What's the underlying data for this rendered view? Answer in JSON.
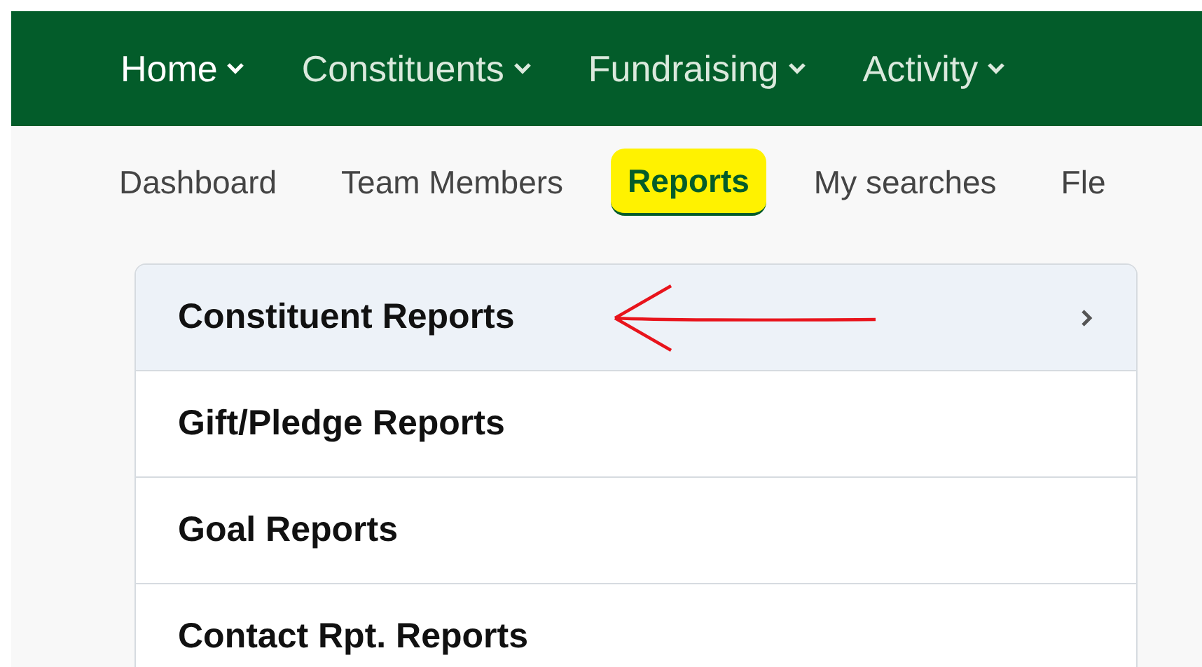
{
  "main_nav": [
    {
      "label": "Home",
      "selected": true
    },
    {
      "label": "Constituents",
      "selected": false
    },
    {
      "label": "Fundraising",
      "selected": false
    },
    {
      "label": "Activity",
      "selected": false
    }
  ],
  "sub_nav": [
    {
      "label": "Dashboard",
      "selected": false,
      "highlighted": false
    },
    {
      "label": "Team Members",
      "selected": false,
      "highlighted": false
    },
    {
      "label": "Reports",
      "selected": true,
      "highlighted": true
    },
    {
      "label": "My searches",
      "selected": false,
      "highlighted": false
    },
    {
      "label": "Fle",
      "selected": false,
      "highlighted": false
    }
  ],
  "report_list": [
    {
      "label": "Constituent Reports",
      "selected": true,
      "annotated": true
    },
    {
      "label": "Gift/Pledge Reports",
      "selected": false,
      "annotated": false
    },
    {
      "label": "Goal Reports",
      "selected": false,
      "annotated": false
    },
    {
      "label": "Contact Rpt. Reports",
      "selected": false,
      "annotated": false
    }
  ]
}
